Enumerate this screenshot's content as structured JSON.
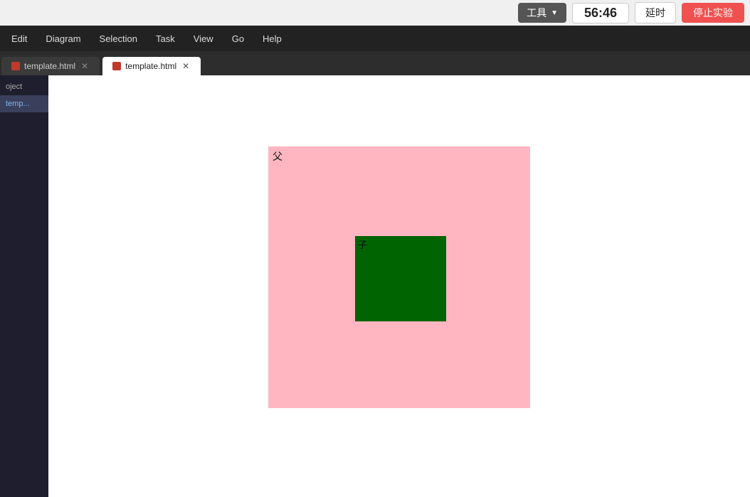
{
  "topbar": {
    "tools_label": "工具",
    "timer": "56:46",
    "extend_label": "延时",
    "stop_label": "停止实验"
  },
  "menubar": {
    "items": [
      "Edit",
      "Diagram",
      "Selection",
      "Task",
      "View",
      "Go",
      "Help"
    ]
  },
  "tabs": [
    {
      "label": "template.html",
      "active": false
    },
    {
      "label": "template.html",
      "active": true
    }
  ],
  "sidebar": {
    "items": [
      {
        "label": "oject",
        "active": false
      },
      {
        "label": "temp...",
        "active": true
      }
    ]
  },
  "canvas": {
    "parent_label": "父",
    "child_label": "子"
  }
}
